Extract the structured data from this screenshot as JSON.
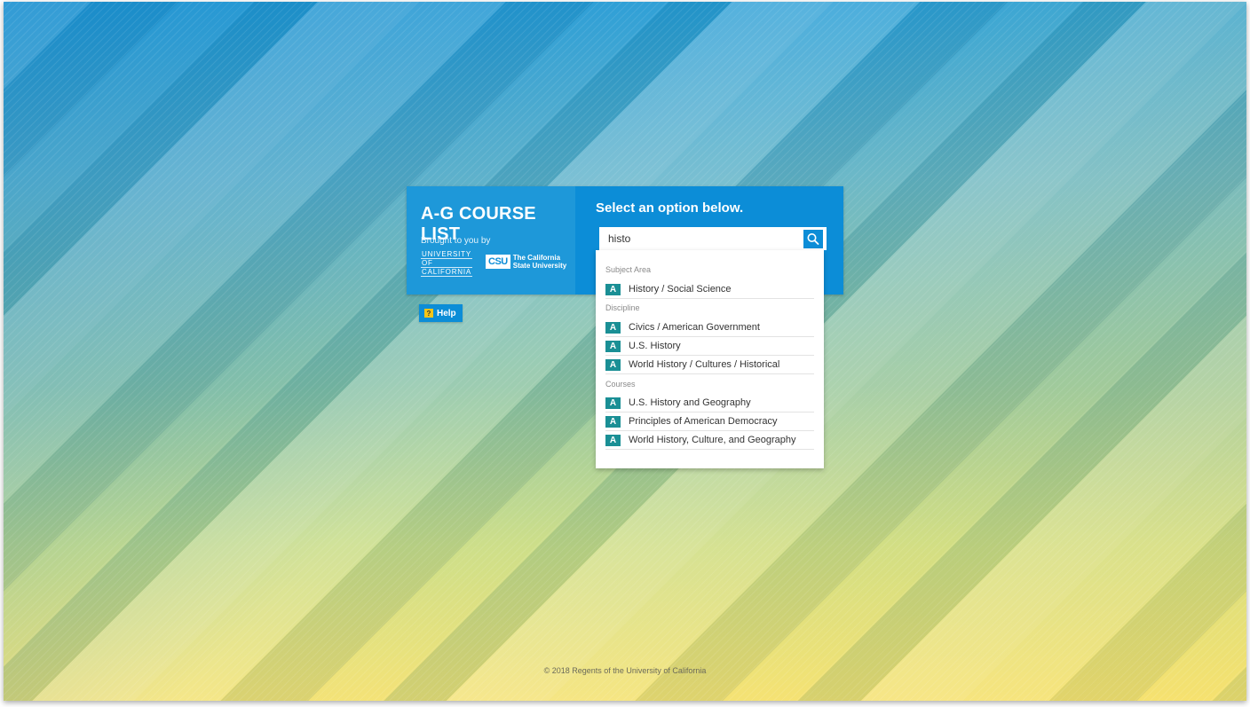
{
  "brand": {
    "title": "A-G COURSE LIST",
    "brought_by": "Brought to you by",
    "uc_logo_lines": [
      "UNIVERSITY",
      "OF",
      "CALIFORNIA"
    ],
    "csu_badge": "CSU",
    "csu_name": "The California State University"
  },
  "search": {
    "prompt": "Select an option below.",
    "value": "histo",
    "icon": "search-icon"
  },
  "help": {
    "label": "Help",
    "icon_glyph": "?"
  },
  "dropdown": {
    "groups": [
      {
        "label": "Subject Area",
        "options": [
          {
            "badge": "A",
            "label": "History / Social Science"
          }
        ]
      },
      {
        "label": "Discipline",
        "options": [
          {
            "badge": "A",
            "label": "Civics / American Government"
          },
          {
            "badge": "A",
            "label": "U.S. History"
          },
          {
            "badge": "A",
            "label": "World History / Cultures / Historical"
          }
        ]
      },
      {
        "label": "Courses",
        "options": [
          {
            "badge": "A",
            "label": "U.S. History and Geography"
          },
          {
            "badge": "A",
            "label": "Principles of American Democracy"
          },
          {
            "badge": "A",
            "label": "World History, Culture, and Geography"
          }
        ]
      }
    ]
  },
  "footer": {
    "copyright": "© 2018 Regents of the University of California"
  },
  "colors": {
    "primary_blue": "#0c8dd7",
    "badge_teal": "#1a8f95",
    "help_yellow": "#f5c518"
  }
}
